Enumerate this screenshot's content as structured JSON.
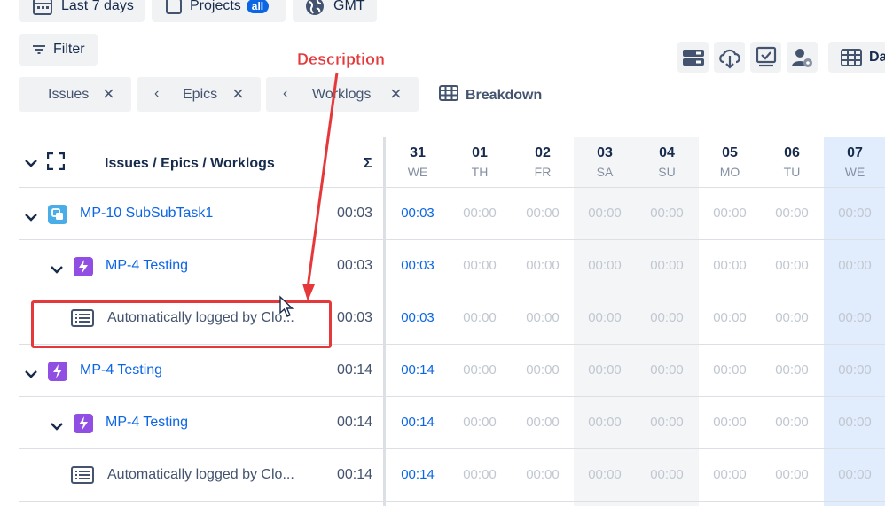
{
  "toolbar": {
    "date_range": "Last 7 days",
    "projects_label": "Projects",
    "projects_badge": "all",
    "timezone": "GMT",
    "filter_label": "Filter",
    "day_view_label": "Da"
  },
  "chips": [
    {
      "label": "Issues"
    },
    {
      "label": "Epics"
    },
    {
      "label": "Worklogs"
    }
  ],
  "breakdown_label": "Breakdown",
  "annotation": {
    "label": "Description",
    "color": "#e5383b"
  },
  "table": {
    "header_title": "Issues / Epics / Worklogs",
    "sum_symbol": "Σ",
    "days": [
      {
        "day": "31",
        "weekday": "WE"
      },
      {
        "day": "01",
        "weekday": "TH"
      },
      {
        "day": "02",
        "weekday": "FR"
      },
      {
        "day": "03",
        "weekday": "SA"
      },
      {
        "day": "04",
        "weekday": "SU"
      },
      {
        "day": "05",
        "weekday": "MO"
      },
      {
        "day": "06",
        "weekday": "TU"
      },
      {
        "day": "07",
        "weekday": "WE"
      }
    ],
    "rows": [
      {
        "label": "MP-10 SubSubTask1",
        "total": "00:03",
        "values": [
          "00:03",
          "00:00",
          "00:00",
          "00:00",
          "00:00",
          "00:00",
          "00:00",
          "00:00"
        ]
      },
      {
        "label": "MP-4 Testing",
        "total": "00:03",
        "values": [
          "00:03",
          "00:00",
          "00:00",
          "00:00",
          "00:00",
          "00:00",
          "00:00",
          "00:00"
        ]
      },
      {
        "label": "Automatically logged by Clo...",
        "total": "00:03",
        "values": [
          "00:03",
          "00:00",
          "00:00",
          "00:00",
          "00:00",
          "00:00",
          "00:00",
          "00:00"
        ]
      },
      {
        "label": "MP-4 Testing",
        "total": "00:14",
        "values": [
          "00:14",
          "00:00",
          "00:00",
          "00:00",
          "00:00",
          "00:00",
          "00:00",
          "00:00"
        ]
      },
      {
        "label": "MP-4 Testing",
        "total": "00:14",
        "values": [
          "00:14",
          "00:00",
          "00:00",
          "00:00",
          "00:00",
          "00:00",
          "00:00",
          "00:00"
        ]
      },
      {
        "label": "Automatically logged by Clo...",
        "total": "00:14",
        "values": [
          "00:14",
          "00:00",
          "00:00",
          "00:00",
          "00:00",
          "00:00",
          "00:00",
          "00:00"
        ]
      }
    ]
  },
  "colors": {
    "link": "#0c66e4",
    "weekend_bg": "#f4f5f7",
    "today_bg": "#e1ecfd",
    "subtask_icon": "#4bade8",
    "epic_icon": "#904ee2"
  }
}
